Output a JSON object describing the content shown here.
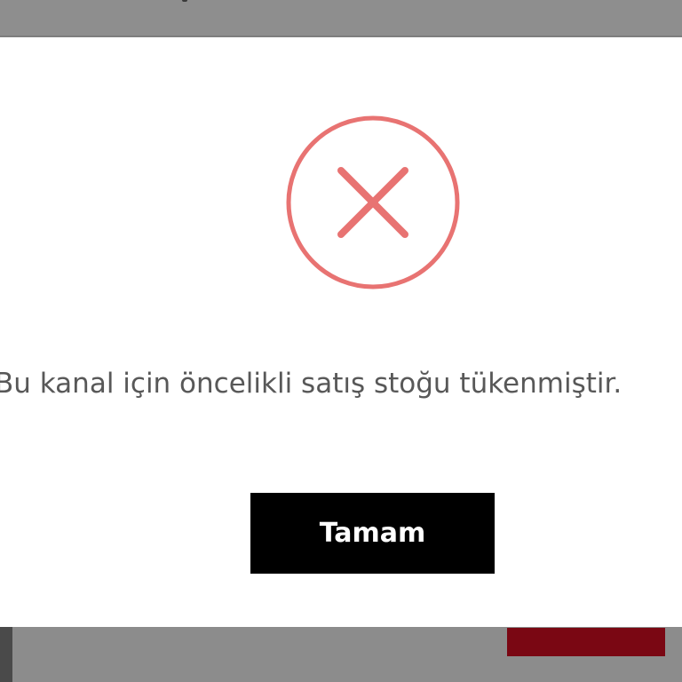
{
  "dialog": {
    "message": "Bu kanal için öncelikli satış stoğu tükenmiştir.",
    "confirm_label": "Tamam",
    "icon": "error-x-circle-icon"
  },
  "colors": {
    "icon_accent": "#e87372",
    "button_bg": "#000000",
    "button_text": "#ffffff",
    "message_text": "#585858",
    "overlay": "#8f8f8f",
    "background_button": "#7a0713"
  }
}
